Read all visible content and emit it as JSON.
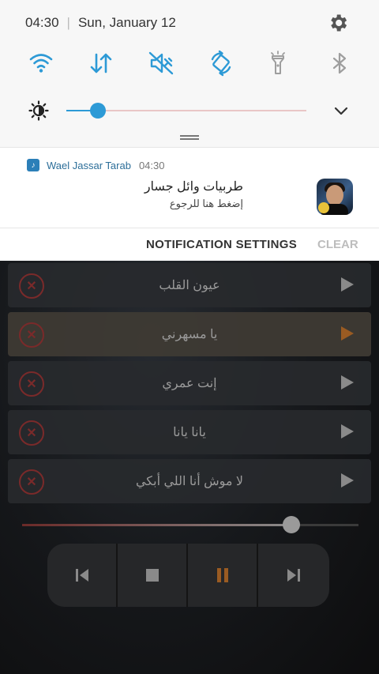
{
  "status": {
    "time": "04:30",
    "date": "Sun, January 12"
  },
  "quick_toggles": [
    {
      "name": "wifi-icon",
      "active": true
    },
    {
      "name": "mobile-data-icon",
      "active": true
    },
    {
      "name": "mute-icon",
      "active": true
    },
    {
      "name": "auto-rotate-icon",
      "active": true
    },
    {
      "name": "flashlight-icon",
      "active": false
    },
    {
      "name": "bluetooth-icon",
      "active": false
    }
  ],
  "brightness": {
    "level": 0.13
  },
  "colors": {
    "accent": "#2d9ad6",
    "accent_dark": "#2c6e99",
    "remove": "#7a2a2a",
    "pause": "#9a5b22"
  },
  "notification": {
    "app_name": "Wael Jassar Tarab",
    "time": "04:30",
    "title": "طربيات وائل جسار",
    "subtitle": "إضغط هنا للرجوع",
    "settings_label": "NOTIFICATION SETTINGS",
    "clear_label": "CLEAR"
  },
  "tracks": [
    {
      "title": "عيون القلب",
      "active": false
    },
    {
      "title": "يا مسهرني",
      "active": true
    },
    {
      "title": "إنت عمري",
      "active": false
    },
    {
      "title": "يانا يانا",
      "active": false
    },
    {
      "title": "لا موش أنا اللي أبكي",
      "active": false
    }
  ],
  "player": {
    "progress": 0.8
  }
}
